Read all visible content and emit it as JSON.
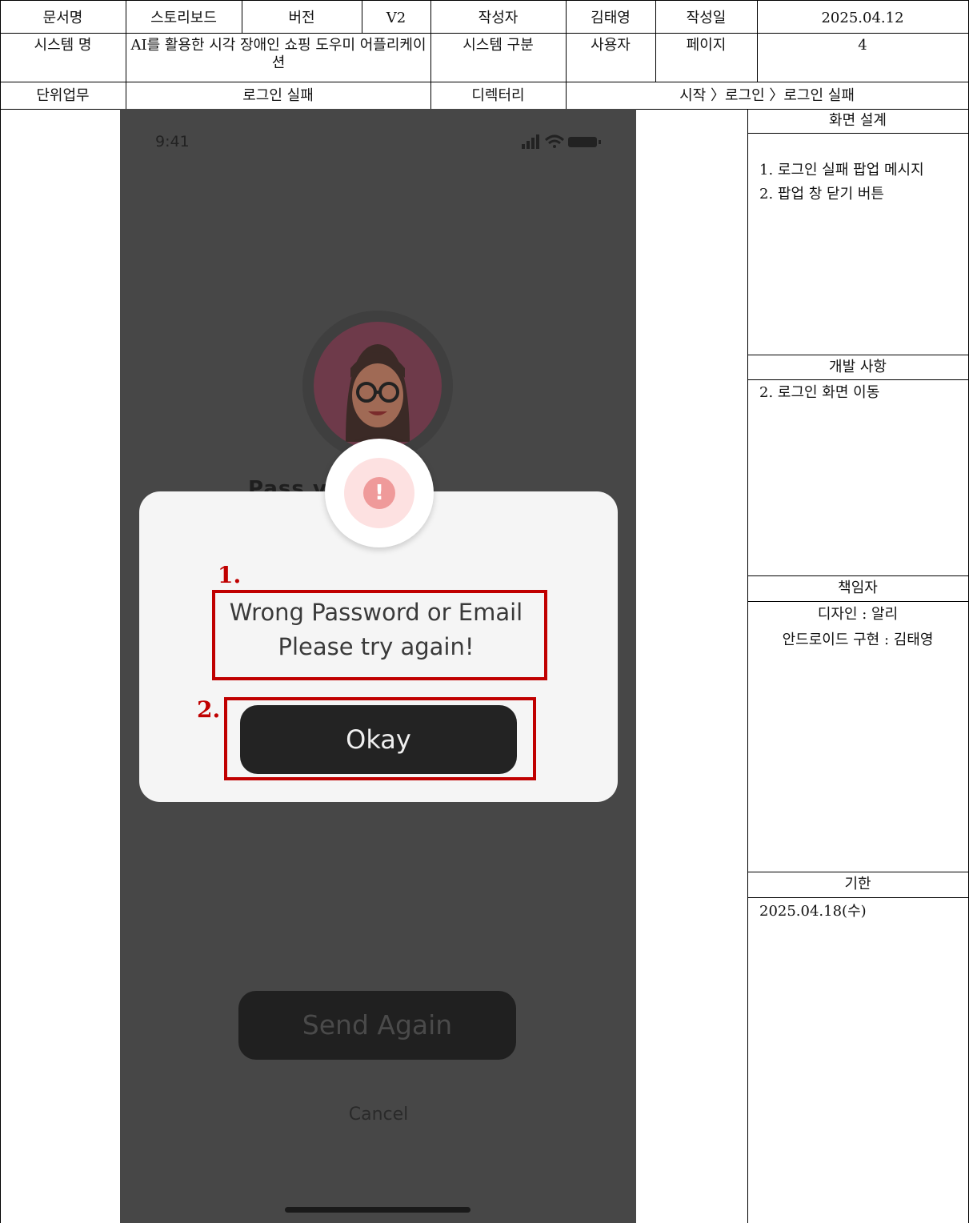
{
  "header": {
    "doc_name_label": "문서명",
    "doc_name_value": "스토리보드",
    "version_label": "버전",
    "version_value": "V2",
    "author_label": "작성자",
    "author_value": "김태영",
    "date_label": "작성일",
    "date_value": "2025.04.12",
    "system_name_label": "시스템 명",
    "system_name_value": "AI를 활용한 시각 장애인 쇼핑 도우미 어플리케이션",
    "system_type_label": "시스템 구분",
    "system_type_value": "사용자",
    "page_label": "페이지",
    "page_value": "4",
    "unit_task_label": "단위업무",
    "unit_task_value": "로그인 실패",
    "directory_label": "디렉터리",
    "directory_value": "시작 〉로그인 〉로그인 실패"
  },
  "phone": {
    "status_time": "9:41",
    "partial_title": "Pass       very",
    "modal_message_line1": "Wrong Password or Email",
    "modal_message_line2": "Please try again!",
    "okay_label": "Okay",
    "send_again_label": "Send Again",
    "cancel_label": "Cancel",
    "annotation_1": "1.",
    "annotation_2": "2.",
    "alert_symbol": "!"
  },
  "side": {
    "screen_design_title": "화면 설계",
    "screen_design_item1": "1. 로그인 실패 팝업 메시지",
    "screen_design_item2": "2. 팝업 창 닫기 버튼",
    "dev_title": "개발 사항",
    "dev_item1": "2. 로그인 화면 이동",
    "owner_title": "책임자",
    "owner_design": "디자인 : 알리",
    "owner_android": "안드로이드 구현 : 김태영",
    "deadline_title": "기한",
    "deadline_value": "2025.04.18(수)"
  },
  "colors": {
    "annotation_red": "#c00000",
    "overlay_gray": "#474747",
    "alert_pink": "#ef9a9a"
  }
}
